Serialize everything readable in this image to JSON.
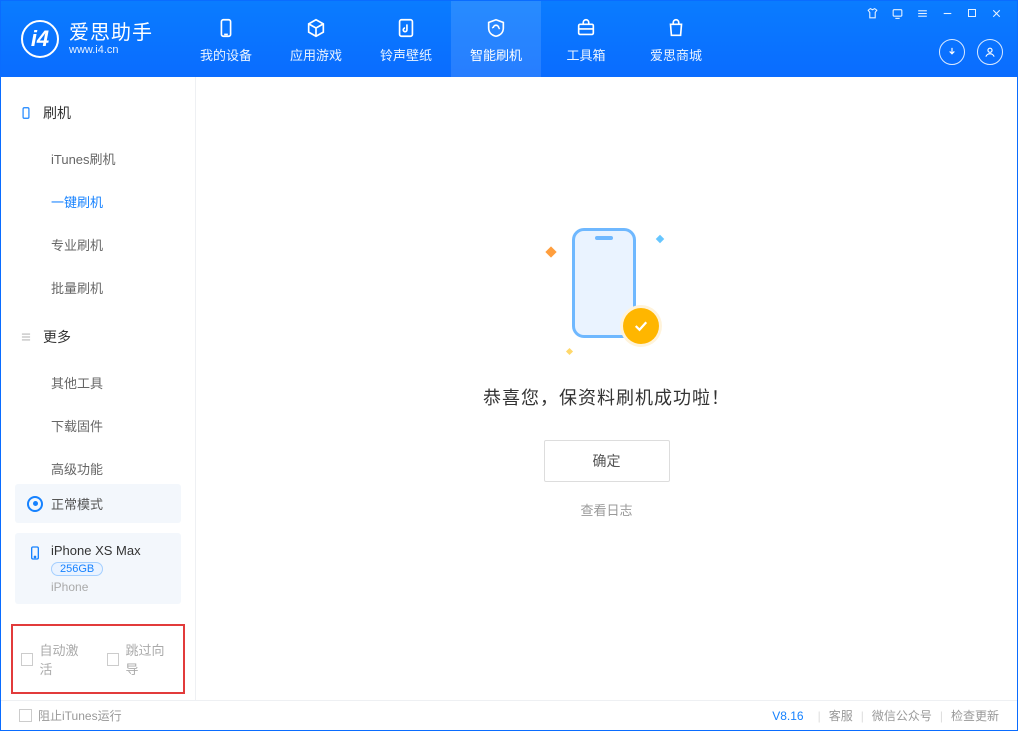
{
  "app": {
    "title": "爱思助手",
    "url": "www.i4.cn"
  },
  "nav": [
    {
      "label": "我的设备"
    },
    {
      "label": "应用游戏"
    },
    {
      "label": "铃声壁纸"
    },
    {
      "label": "智能刷机"
    },
    {
      "label": "工具箱"
    },
    {
      "label": "爱思商城"
    }
  ],
  "sidebar": {
    "group1_label": "刷机",
    "group1_items": [
      "iTunes刷机",
      "一键刷机",
      "专业刷机",
      "批量刷机"
    ],
    "group2_label": "更多",
    "group2_items": [
      "其他工具",
      "下载固件",
      "高级功能"
    ]
  },
  "mode": {
    "label": "正常模式"
  },
  "device": {
    "name": "iPhone XS Max",
    "capacity": "256GB",
    "type": "iPhone"
  },
  "checks": {
    "auto_activate": "自动激活",
    "skip_guide": "跳过向导"
  },
  "main": {
    "success": "恭喜您，保资料刷机成功啦！",
    "ok": "确定",
    "view_log": "查看日志"
  },
  "footer": {
    "block_itunes": "阻止iTunes运行",
    "version": "V8.16",
    "links": [
      "客服",
      "微信公众号",
      "检查更新"
    ]
  }
}
